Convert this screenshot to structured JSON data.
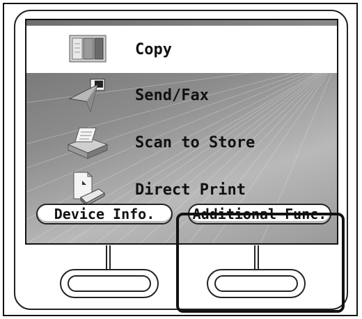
{
  "menu": {
    "items": [
      {
        "label": "Copy",
        "icon": "copy-icon",
        "selected": true
      },
      {
        "label": "Send/Fax",
        "icon": "send-fax-icon",
        "selected": false
      },
      {
        "label": "Scan to Store",
        "icon": "scan-icon",
        "selected": false
      },
      {
        "label": "Direct Print",
        "icon": "direct-print-icon",
        "selected": false
      }
    ]
  },
  "soft_keys": {
    "left_label": "Device Info.",
    "right_label": "Additional Func."
  }
}
